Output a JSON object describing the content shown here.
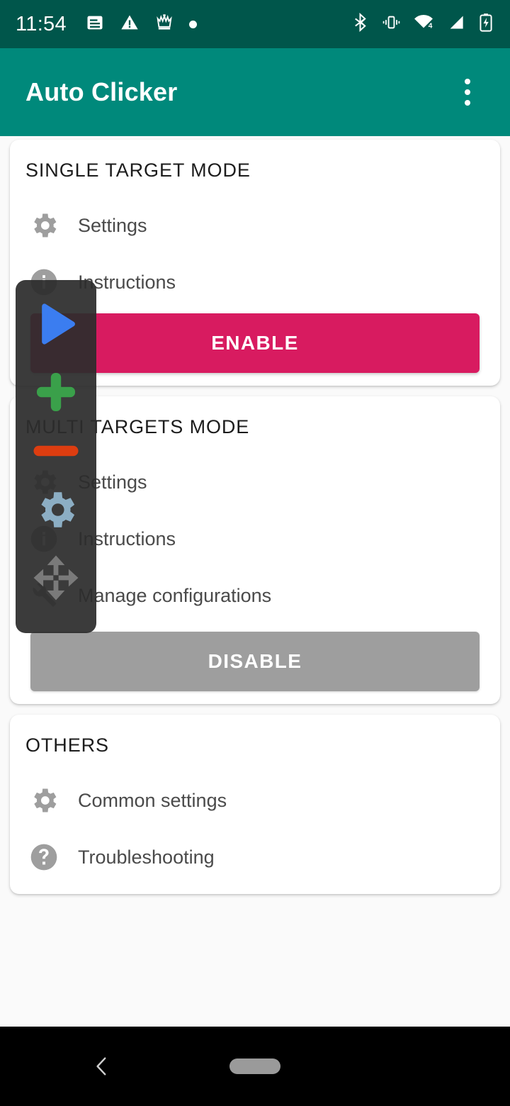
{
  "status_bar": {
    "time": "11:54",
    "background_color": "#00564b",
    "left_icons": [
      "notes-notification-icon",
      "warning-triangle-icon",
      "chess-king-icon",
      "dot-notification-icon"
    ],
    "right_icons": [
      "bluetooth-icon",
      "vibrate-icon",
      "wifi-icon",
      "cellular-signal-icon",
      "battery-charging-icon"
    ],
    "wifi_badge": "4"
  },
  "app_bar": {
    "title": "Auto Clicker",
    "background_color": "#00897b",
    "overflow_menu": "overflow-menu-icon"
  },
  "cards": {
    "single": {
      "title": "SINGLE TARGET MODE",
      "items": [
        {
          "label": "Settings",
          "icon": "gear-icon"
        },
        {
          "label": "Instructions",
          "icon": "info-icon"
        }
      ],
      "button": {
        "label": "ENABLE",
        "color": "#d81b60",
        "enabled": "true"
      }
    },
    "multi": {
      "title": "MULTI TARGETS MODE",
      "items": [
        {
          "label": "Settings",
          "icon": "gear-icon"
        },
        {
          "label": "Instructions",
          "icon": "info-icon"
        },
        {
          "label": "Manage configurations",
          "icon": "wrench-icon"
        }
      ],
      "button": {
        "label": "DISABLE",
        "color": "#9e9e9e",
        "enabled": "false"
      }
    },
    "others": {
      "title": "OTHERS",
      "items": [
        {
          "label": "Common settings",
          "icon": "gear-icon"
        },
        {
          "label": "Troubleshooting",
          "icon": "question-circle-icon"
        }
      ]
    }
  },
  "overlay_widget": {
    "background_color": "#2c2c2c",
    "buttons": [
      {
        "name": "play-button",
        "icon": "play-triangle-icon",
        "color": "#3b7df0"
      },
      {
        "name": "add-target-button",
        "icon": "plus-icon",
        "color": "#3aa04a"
      },
      {
        "name": "remove-target-button",
        "icon": "minus-icon",
        "color": "#dd3d10"
      },
      {
        "name": "overlay-settings-button",
        "icon": "gear-icon",
        "color": "#8caec4"
      },
      {
        "name": "move-handle",
        "icon": "move-arrows-icon",
        "color": "#7a7a7a"
      }
    ]
  },
  "nav_bar": {
    "background_color": "#000000",
    "back": "back-chevron-icon",
    "home": "home-pill-icon"
  }
}
